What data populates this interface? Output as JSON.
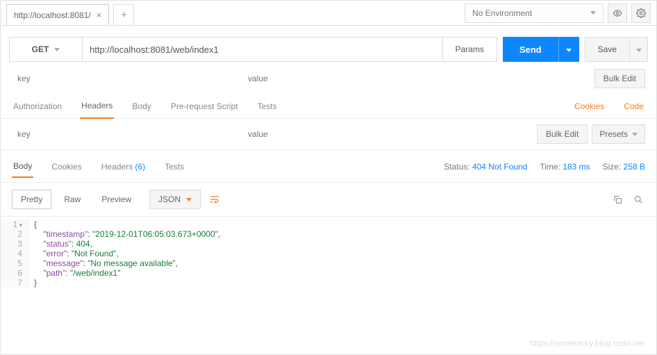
{
  "topbar": {
    "tab_title": "http://localhost:8081/",
    "environment": "No Environment"
  },
  "request": {
    "method": "GET",
    "url": "http://localhost:8081/web/index1",
    "params_label": "Params",
    "send_label": "Send",
    "save_label": "Save",
    "key_ph": "key",
    "value_ph": "value",
    "bulk_label": "Bulk Edit",
    "presets_label": "Presets"
  },
  "req_tabs": {
    "auth": "Authorization",
    "headers": "Headers",
    "body": "Body",
    "pre": "Pre-request Script",
    "tests": "Tests",
    "cookies": "Cookies",
    "code": "Code"
  },
  "res_tabs": {
    "body": "Body",
    "cookies": "Cookies",
    "headers": "Headers",
    "headers_count": "(6)",
    "tests": "Tests"
  },
  "status": {
    "status_label": "Status:",
    "status_value": "404 Not Found",
    "time_label": "Time:",
    "time_value": "183 ms",
    "size_label": "Size:",
    "size_value": "258 B"
  },
  "fmt": {
    "pretty": "Pretty",
    "raw": "Raw",
    "preview": "Preview",
    "lang": "JSON"
  },
  "json_body": {
    "l1": "{",
    "l2k": "\"timestamp\"",
    "l2v": "\"2019-12-01T06:05:03.673+0000\"",
    "l3k": "\"status\"",
    "l3v": "404",
    "l4k": "\"error\"",
    "l4v": "\"Not Found\"",
    "l5k": "\"message\"",
    "l5v": "\"No message available\"",
    "l6k": "\"path\"",
    "l6v": "\"/web/index1\"",
    "l7": "}"
  },
  "watermark": "https://smilenicky.blog.csdn.net"
}
